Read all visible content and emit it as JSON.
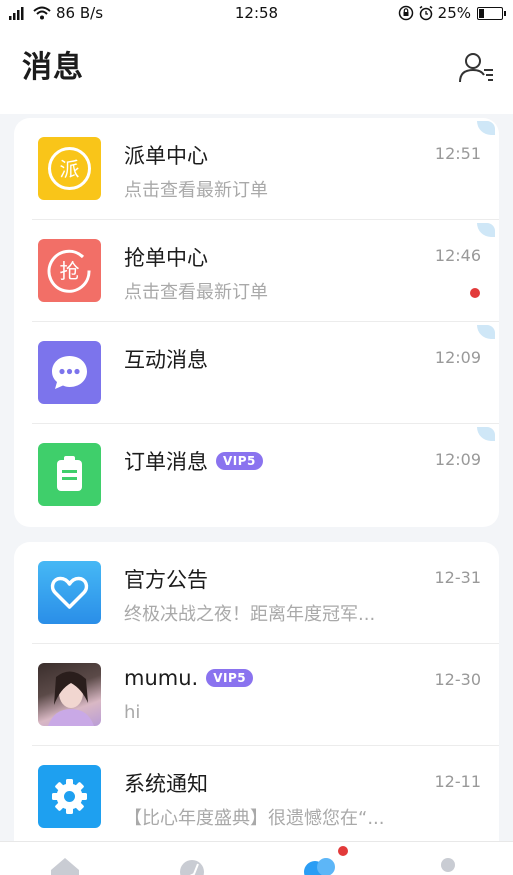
{
  "status_bar": {
    "signal_text": "⁴ᴳ",
    "network_speed": "86 B/s",
    "time": "12:58",
    "battery_percent": "25%",
    "battery_level": 0.25
  },
  "header": {
    "title": "消息"
  },
  "group1": [
    {
      "name": "派单中心",
      "subtitle": "点击查看最新订单",
      "time": "12:51",
      "icon": "dispatch-icon",
      "icon_char": "派",
      "icon_bg": "#f9c519",
      "unread": false
    },
    {
      "name": "抢单中心",
      "subtitle": "点击查看最新订单",
      "time": "12:46",
      "icon": "grab-order-icon",
      "icon_char": "抢",
      "icon_bg": "#f26f67",
      "unread": true
    },
    {
      "name": "互动消息",
      "subtitle": "",
      "time": "12:09",
      "icon": "chat-bubble-icon",
      "icon_bg": "#7c74ec",
      "unread": false
    },
    {
      "name": "订单消息",
      "vip": "VIP5",
      "subtitle": "",
      "time": "12:09",
      "icon": "clipboard-icon",
      "icon_bg": "#3fcf6b",
      "unread": false
    }
  ],
  "group2": [
    {
      "name": "官方公告",
      "subtitle": "终极决战之夜！距离年度冠军...",
      "time": "12-31",
      "icon": "heart-icon",
      "icon_bg": "#3aa5f0"
    },
    {
      "name": "mumu.",
      "vip": "VIP5",
      "subtitle": "hi",
      "time": "12-30",
      "icon": "user-photo"
    },
    {
      "name": "系统通知",
      "subtitle": "【比心年度盛典】很遗憾您在“...",
      "time": "12-11",
      "icon": "gear-icon",
      "icon_bg": "#1ea0f0"
    }
  ],
  "colors": {
    "accent": "#2a9df4",
    "badge_red": "#e23a3a",
    "vip_purple": "#8a73ef"
  }
}
